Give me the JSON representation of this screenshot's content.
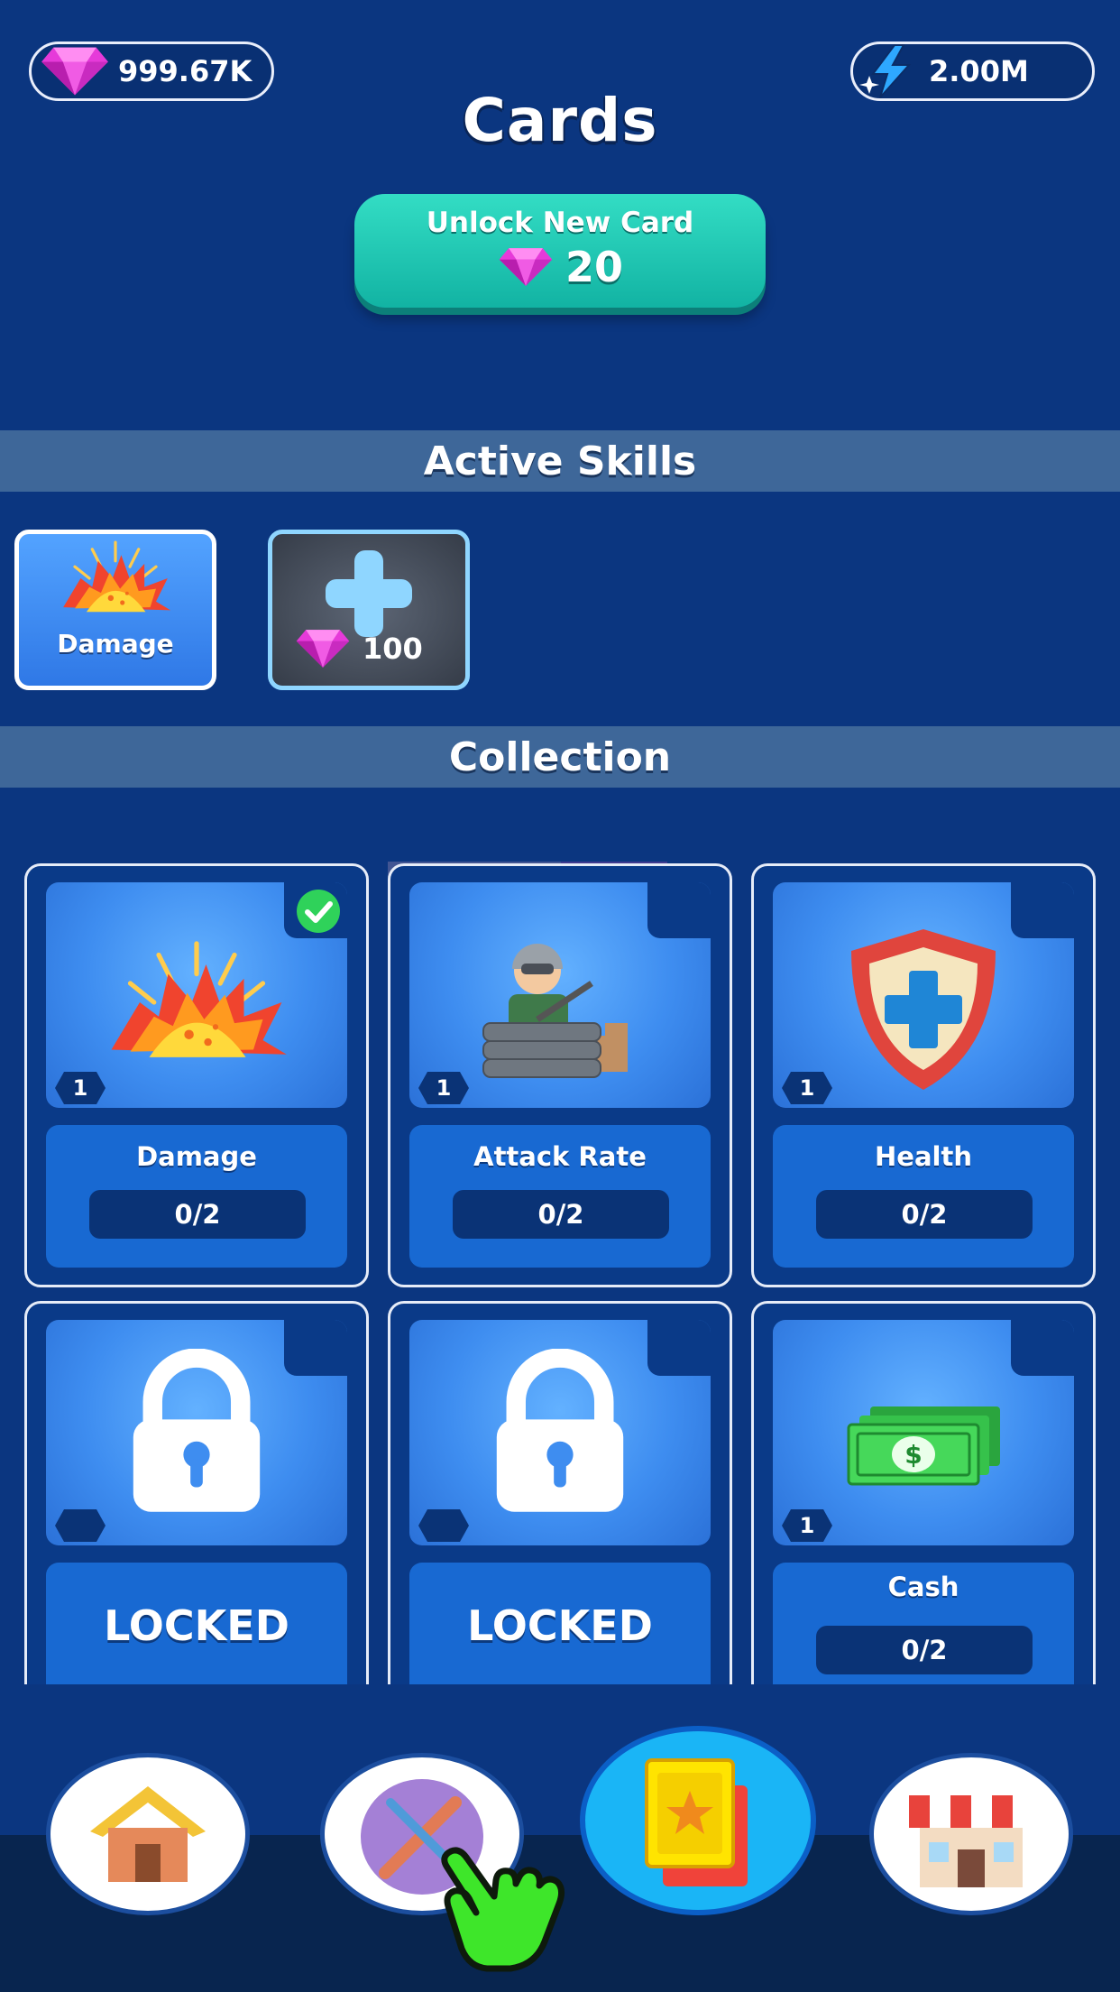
{
  "currency": {
    "gems": "999.67K",
    "energy": "2.00M"
  },
  "header": {
    "title": "Cards",
    "unlock_label": "Unlock New Card",
    "unlock_cost": "20"
  },
  "active_skills": {
    "heading": "Active Skills",
    "slots": [
      {
        "name": "Damage",
        "icon": "explosion-icon"
      },
      {
        "name": "add-slot",
        "cost": "100",
        "icon": "plus-icon"
      }
    ]
  },
  "collection": {
    "heading": "Collection",
    "cards": [
      {
        "name": "Damage",
        "level": "1",
        "progress": "0/2",
        "equipped": true,
        "icon": "explosion-icon"
      },
      {
        "name": "Attack Rate",
        "level": "1",
        "progress": "0/2",
        "icon": "soldier-icon"
      },
      {
        "name": "Health",
        "level": "1",
        "progress": "0/2",
        "icon": "shield-icon"
      },
      {
        "status": "LOCKED",
        "icon": "lock-icon"
      },
      {
        "status": "LOCKED",
        "icon": "lock-icon"
      },
      {
        "name": "Cash",
        "level": "1",
        "progress": "0/2",
        "icon": "cash-icon"
      }
    ]
  },
  "nav": {
    "items": [
      {
        "icon": "home-icon"
      },
      {
        "icon": "wrench-screwdriver-icon"
      },
      {
        "icon": "cards-icon",
        "active": true
      },
      {
        "icon": "shop-icon"
      }
    ],
    "pointer_icon": "pointing-hand-icon"
  },
  "colors": {
    "background": "#0b3680",
    "accent_teal": "#1fc6b2",
    "gem_pink": "#e53fd6",
    "active_nav": "#1ab5f6"
  }
}
